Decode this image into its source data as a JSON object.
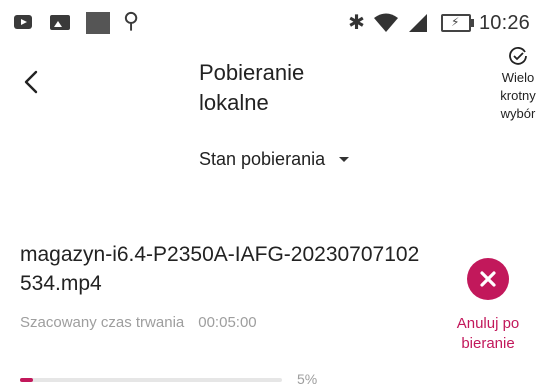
{
  "status_bar": {
    "icons_left": [
      "youtube-icon",
      "image-icon",
      "app-icon",
      "usb-icon"
    ],
    "icons_right": [
      "bluetooth-icon",
      "wifi-icon",
      "signal-icon",
      "battery-icon"
    ],
    "time": "10:26"
  },
  "header": {
    "title": "Pobieranie lokalne",
    "multi_select_label": "Wielo\nkrotny\nwybór"
  },
  "filter": {
    "label": "Stan pobierania"
  },
  "download": {
    "filename": "magazyn-i6.4-P2350A-IAFG-20230707102534.mp4",
    "duration_label": "Szacowany czas trwania",
    "duration_value": "00:05:00",
    "progress_percent": 5,
    "progress_text": "5%",
    "cancel_label": "Anuluj po\nbieranie"
  },
  "colors": {
    "accent": "#c2185b",
    "secondary_text": "#9e9e9e"
  }
}
